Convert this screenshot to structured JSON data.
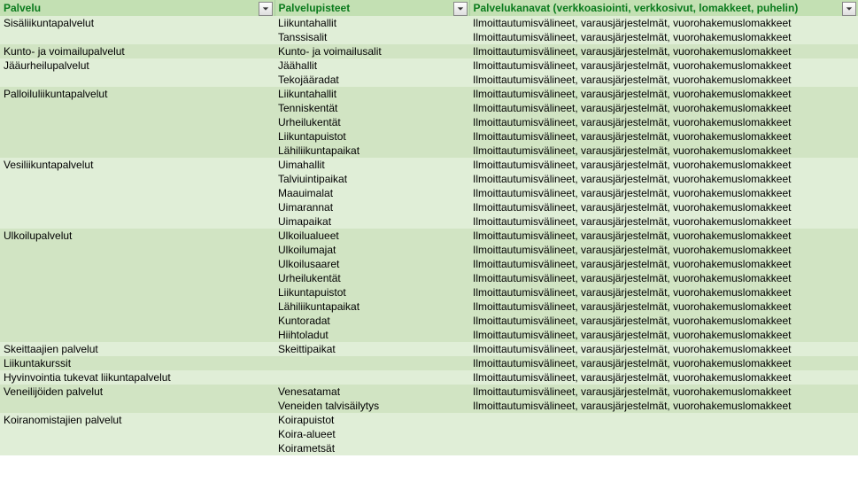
{
  "headers": {
    "col1": "Palvelu",
    "col2": "Palvelupisteet",
    "col3": "Palvelukanavat (verkkoasiointi, verkkosivut, lomakkeet, puhelin)"
  },
  "channel_text": "Ilmoittautumisvälineet, varausjärjestelmät, vuorohakemuslomakkeet",
  "groups": [
    {
      "service": "Sisäliikuntapalvelut",
      "rows": [
        {
          "point": "Liikuntahallit",
          "chan": true
        },
        {
          "point": "Tanssisalit",
          "chan": true
        }
      ]
    },
    {
      "service": "Kunto- ja voimailupalvelut",
      "rows": [
        {
          "point": "Kunto- ja voimailusalit",
          "chan": true
        }
      ]
    },
    {
      "service": "Jääurheilupalvelut",
      "rows": [
        {
          "point": "Jäähallit",
          "chan": true
        },
        {
          "point": "Tekojääradat",
          "chan": true
        }
      ]
    },
    {
      "service": "Palloiluliikuntapalvelut",
      "rows": [
        {
          "point": "Liikuntahallit",
          "chan": true
        },
        {
          "point": "Tenniskentät",
          "chan": true
        },
        {
          "point": "Urheilukentät",
          "chan": true
        },
        {
          "point": "Liikuntapuistot",
          "chan": true
        },
        {
          "point": "Lähiliikuntapaikat",
          "chan": true
        }
      ]
    },
    {
      "service": "Vesiliikuntapalvelut",
      "rows": [
        {
          "point": "Uimahallit",
          "chan": true
        },
        {
          "point": "Talviuintipaikat",
          "chan": true
        },
        {
          "point": "Maauimalat",
          "chan": true
        },
        {
          "point": "Uimarannat",
          "chan": true
        },
        {
          "point": "Uimapaikat",
          "chan": true
        }
      ]
    },
    {
      "service": "Ulkoilupalvelut",
      "rows": [
        {
          "point": "Ulkoilualueet",
          "chan": true
        },
        {
          "point": "Ulkoilumajat",
          "chan": true
        },
        {
          "point": "Ulkoilusaaret",
          "chan": true
        },
        {
          "point": "Urheilukentät",
          "chan": true
        },
        {
          "point": "Liikuntapuistot",
          "chan": true
        },
        {
          "point": "Lähiliikuntapaikat",
          "chan": true
        },
        {
          "point": "Kuntoradat",
          "chan": true
        },
        {
          "point": "Hiihtoladut",
          "chan": true
        }
      ]
    },
    {
      "service": "Skeittaajien palvelut",
      "rows": [
        {
          "point": "Skeittipaikat",
          "chan": true
        }
      ]
    },
    {
      "service": "Liikuntakurssit",
      "rows": [
        {
          "point": "",
          "chan": true
        }
      ]
    },
    {
      "service": "Hyvinvointia tukevat liikuntapalvelut",
      "rows": [
        {
          "point": "",
          "chan": true
        }
      ]
    },
    {
      "service": "Veneilijöiden palvelut",
      "rows": [
        {
          "point": "Venesatamat",
          "chan": true
        },
        {
          "point": "Veneiden talvisäilytys",
          "chan": true
        }
      ]
    },
    {
      "service": "Koiranomistajien palvelut",
      "rows": [
        {
          "point": "Koirapuistot",
          "chan": false
        },
        {
          "point": "Koira-alueet",
          "chan": false
        },
        {
          "point": "Koirametsät",
          "chan": false
        }
      ]
    }
  ]
}
